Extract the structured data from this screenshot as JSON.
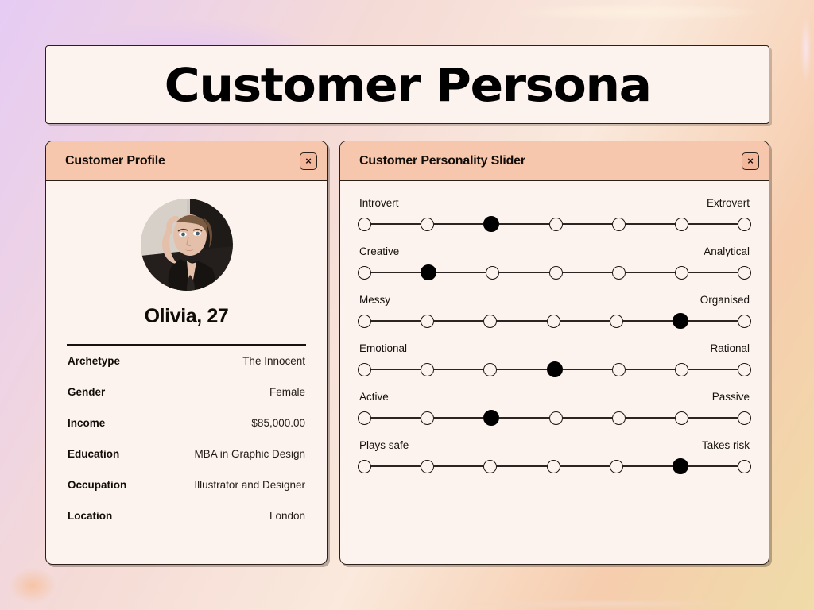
{
  "page": {
    "title": "Customer Persona",
    "background_colors": {
      "lavender": "#e8c9f7",
      "pale_pink": "#fbe3e9",
      "peach": "#f6c4a6",
      "cream_yellow": "#efdba6"
    }
  },
  "profile_card": {
    "header_title": "Customer Profile",
    "close_label": "×",
    "header_color": "#f6c6ad",
    "name": "Olivia, 27",
    "avatar_alt": "portrait-photo",
    "rows": [
      {
        "key": "Archetype",
        "value": "The Innocent"
      },
      {
        "key": "Gender",
        "value": "Female"
      },
      {
        "key": "Income",
        "value": "$85,000.00"
      },
      {
        "key": "Education",
        "value": "MBA in Graphic Design"
      },
      {
        "key": "Occupation",
        "value": "Illustrator and Designer"
      },
      {
        "key": "Location",
        "value": "London"
      }
    ]
  },
  "slider_card": {
    "header_title": "Customer Personality Slider",
    "close_label": "×",
    "header_color": "#f6c6ad",
    "steps": 7,
    "rows": [
      {
        "left_label": "Introvert",
        "right_label": "Extrovert",
        "value": 2
      },
      {
        "left_label": "Creative",
        "right_label": "Analytical",
        "value": 1
      },
      {
        "left_label": "Messy",
        "right_label": "Organised",
        "value": 5
      },
      {
        "left_label": "Emotional",
        "right_label": "Rational",
        "value": 3
      },
      {
        "left_label": "Active",
        "right_label": "Passive",
        "value": 2
      },
      {
        "left_label": "Plays safe",
        "right_label": "Takes risk",
        "value": 5
      }
    ]
  }
}
